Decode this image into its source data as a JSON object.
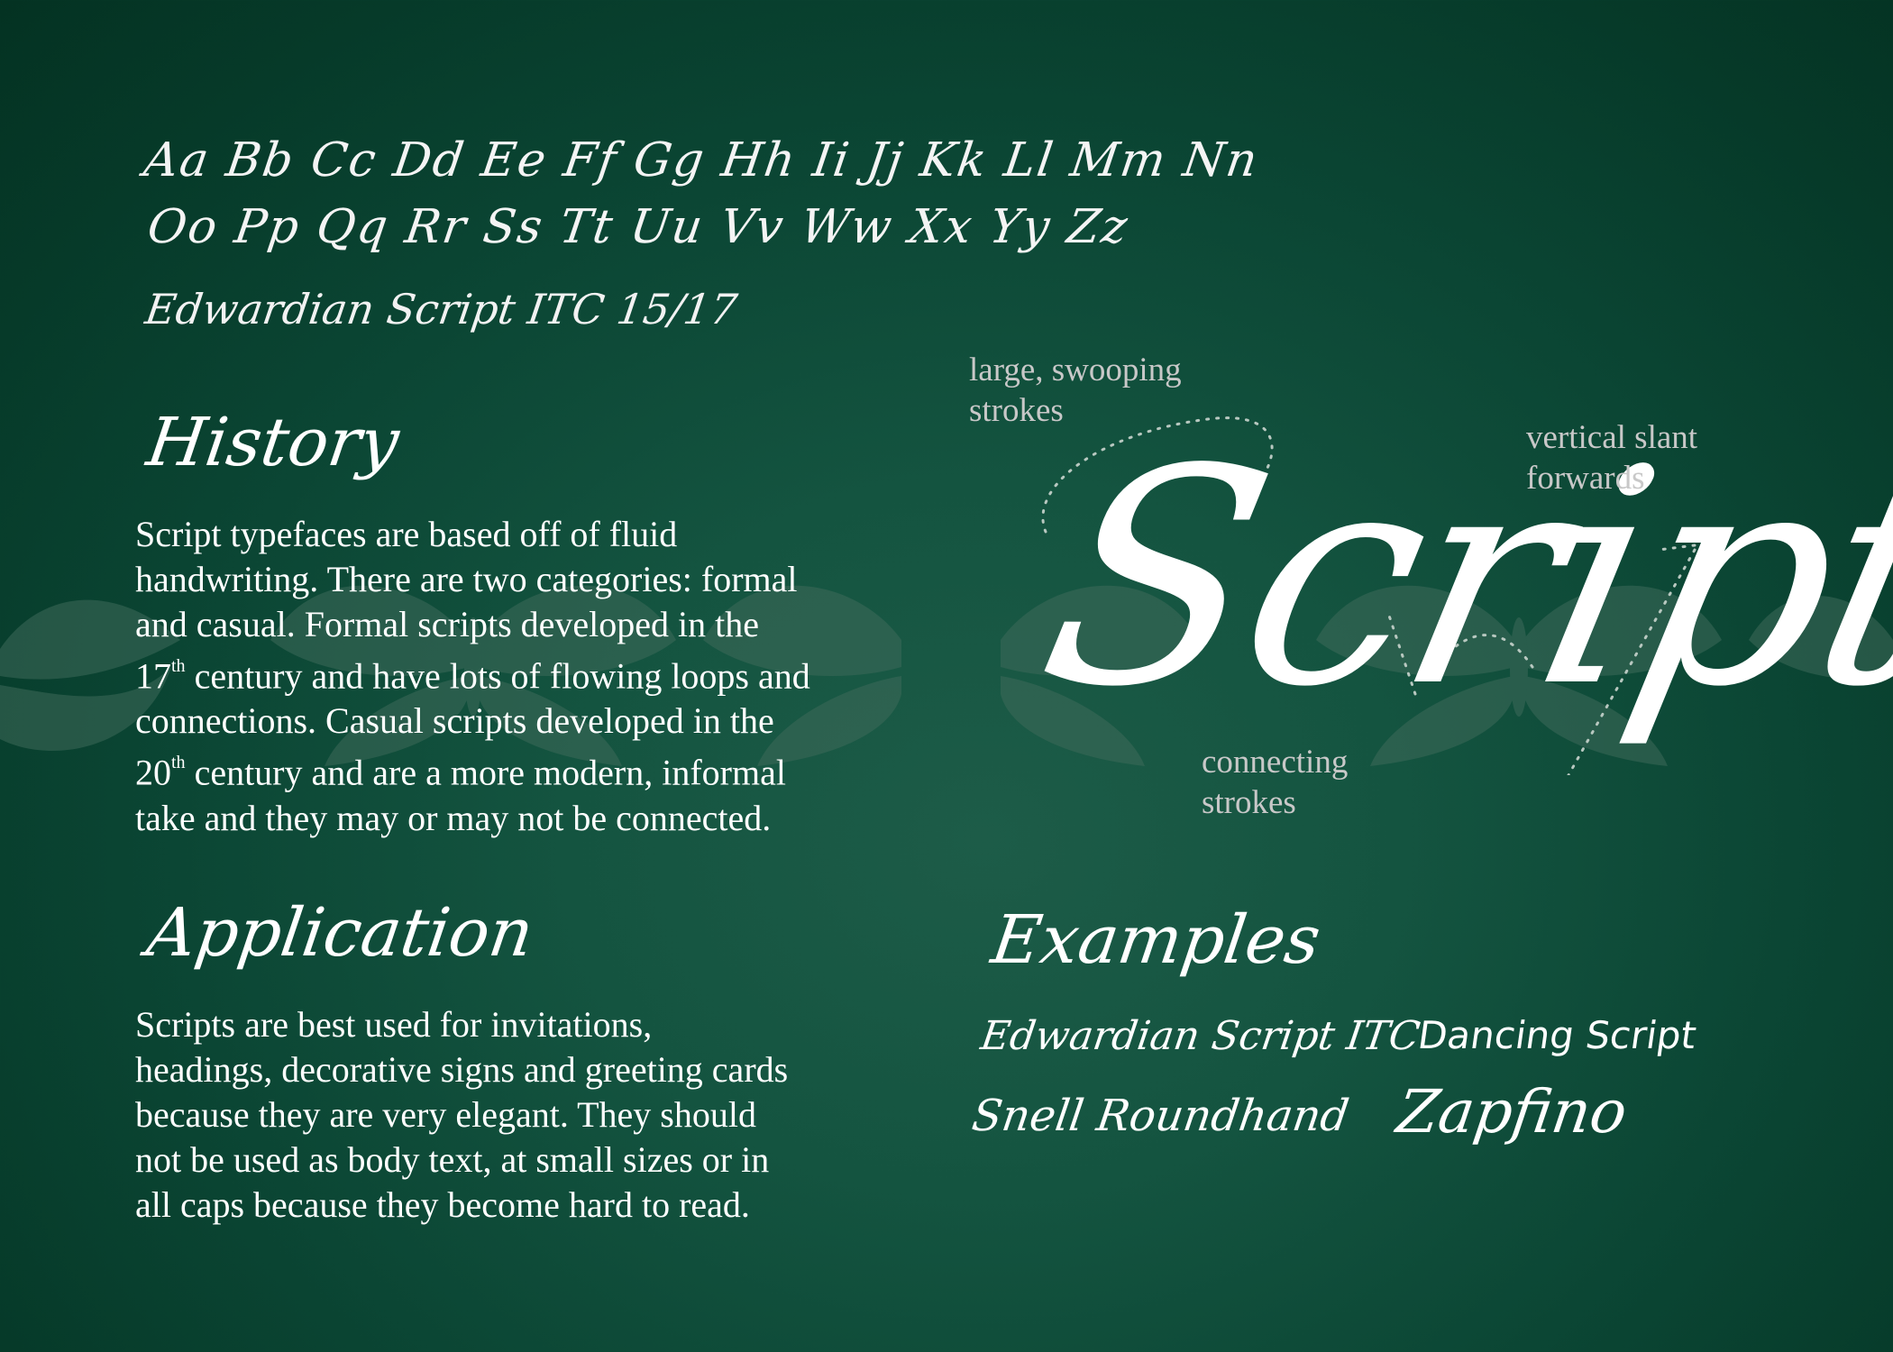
{
  "alphabet": {
    "line1": "Aa Bb Cc Dd Ee Ff Gg Hh Ii Jj Kk Ll Mm Nn",
    "line2": "Oo Pp Qq Rr Ss Tt Uu Vv Ww Xx Yy Zz",
    "caption": "Edwardian Script ITC 15/17"
  },
  "history": {
    "heading": "History",
    "lines": [
      "Script typefaces are based off of fluid",
      "handwriting. There are two categories: formal",
      "and casual. Formal scripts developed in the",
      {
        "pre": "17",
        "sup": "th",
        "post": " century and have lots of flowing loops and"
      },
      "connections. Casual scripts developed in the",
      {
        "pre": "20",
        "sup": "th",
        "post": " century and are a more modern, informal"
      },
      "take and they may or may not be connected."
    ]
  },
  "application": {
    "heading": "Application",
    "lines": [
      "Scripts are best used for invitations,",
      "headings, decorative signs and greeting cards",
      "because they are very elegant. They should",
      "not be used as body text, at small sizes or in",
      "all caps because they become hard to read."
    ]
  },
  "feature": {
    "word": "Script",
    "annotations": {
      "swooping": [
        "large, swooping",
        "strokes"
      ],
      "slant": [
        "vertical slant",
        "forwards"
      ],
      "connecting": [
        "connecting",
        "strokes"
      ]
    }
  },
  "examples": {
    "heading": "Examples",
    "fonts": [
      "Edwardian Script ITC",
      "Dancing Script",
      "Snell Roundhand",
      "Zapfino"
    ]
  },
  "colors": {
    "background": "#0b4634",
    "text": "#ffffff",
    "annotation": "#c8c8c8",
    "moth": "#3e6a5a",
    "dotted": "#b8c8c0"
  }
}
